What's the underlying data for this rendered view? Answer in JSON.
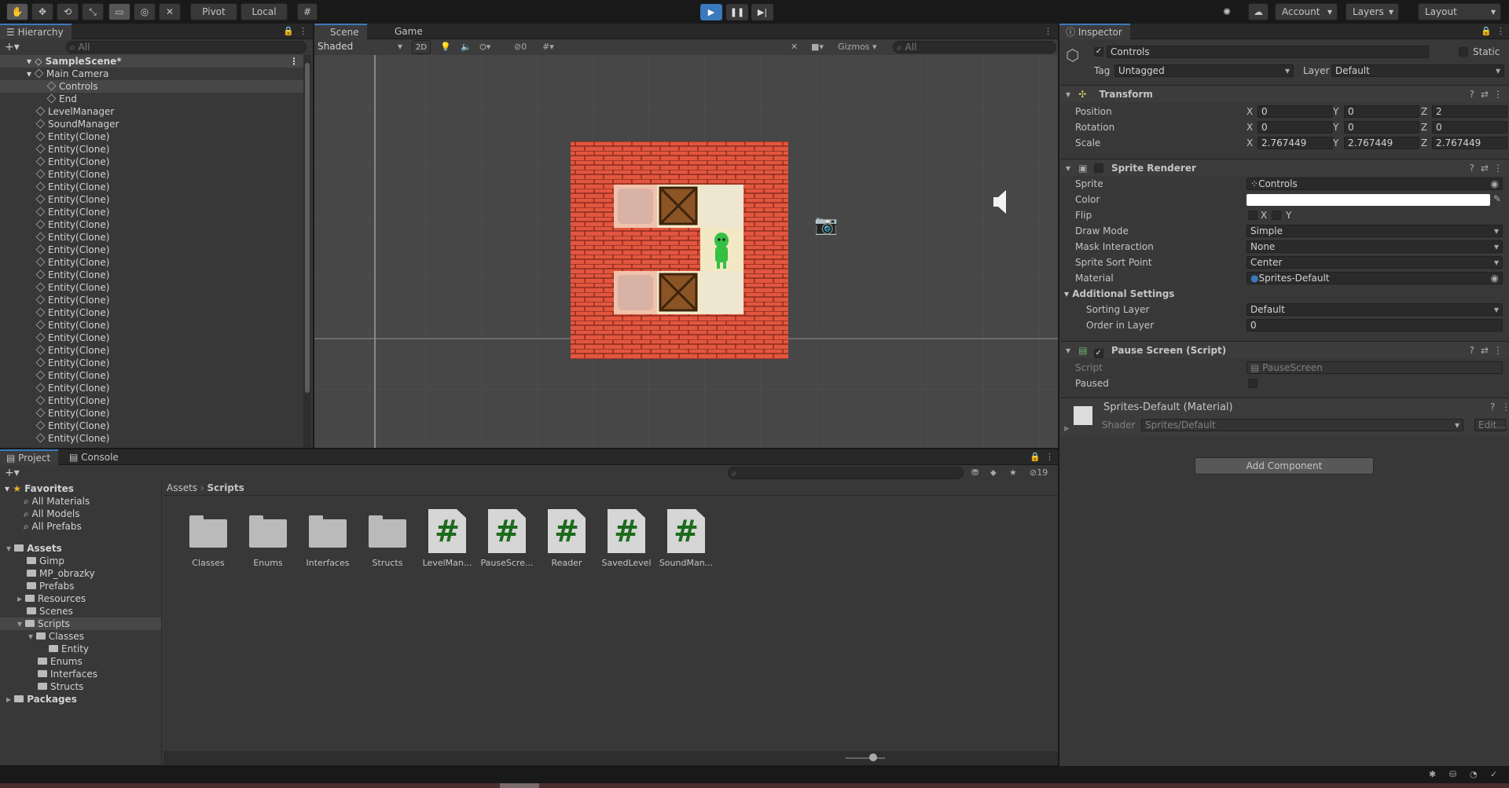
{
  "toolbar": {
    "tools": [
      "hand-tool-icon",
      "move-tool-icon",
      "rotate-tool-icon",
      "scale-tool-icon",
      "rect-tool-icon",
      "transform-tool-icon",
      "custom-tool-icon"
    ],
    "pivot_label": "Pivot",
    "local_label": "Local",
    "account_label": "Account",
    "layers_label": "Layers",
    "layout_label": "Layout"
  },
  "hierarchy": {
    "tab_label": "Hierarchy",
    "search_placeholder": "All",
    "scene_name": "SampleScene*",
    "items": [
      {
        "label": "Main Camera",
        "indent": 1,
        "expanded": true
      },
      {
        "label": "Controls",
        "indent": 2,
        "selected": true
      },
      {
        "label": "End",
        "indent": 2
      },
      {
        "label": "LevelManager",
        "indent": 1
      },
      {
        "label": "SoundManager",
        "indent": 1
      },
      {
        "label": "Entity(Clone)",
        "indent": 1
      },
      {
        "label": "Entity(Clone)",
        "indent": 1
      },
      {
        "label": "Entity(Clone)",
        "indent": 1
      },
      {
        "label": "Entity(Clone)",
        "indent": 1
      },
      {
        "label": "Entity(Clone)",
        "indent": 1
      },
      {
        "label": "Entity(Clone)",
        "indent": 1
      },
      {
        "label": "Entity(Clone)",
        "indent": 1
      },
      {
        "label": "Entity(Clone)",
        "indent": 1
      },
      {
        "label": "Entity(Clone)",
        "indent": 1
      },
      {
        "label": "Entity(Clone)",
        "indent": 1
      },
      {
        "label": "Entity(Clone)",
        "indent": 1
      },
      {
        "label": "Entity(Clone)",
        "indent": 1
      },
      {
        "label": "Entity(Clone)",
        "indent": 1
      },
      {
        "label": "Entity(Clone)",
        "indent": 1
      },
      {
        "label": "Entity(Clone)",
        "indent": 1
      },
      {
        "label": "Entity(Clone)",
        "indent": 1
      },
      {
        "label": "Entity(Clone)",
        "indent": 1
      },
      {
        "label": "Entity(Clone)",
        "indent": 1
      },
      {
        "label": "Entity(Clone)",
        "indent": 1
      },
      {
        "label": "Entity(Clone)",
        "indent": 1
      },
      {
        "label": "Entity(Clone)",
        "indent": 1
      },
      {
        "label": "Entity(Clone)",
        "indent": 1
      },
      {
        "label": "Entity(Clone)",
        "indent": 1
      },
      {
        "label": "Entity(Clone)",
        "indent": 1
      },
      {
        "label": "Entity(Clone)",
        "indent": 1
      }
    ]
  },
  "scene": {
    "scene_tab": "Scene",
    "game_tab": "Game",
    "shading_mode": "Shaded",
    "mode_2d": "2D",
    "hidden_count": "0",
    "gizmos_label": "Gizmos",
    "search_placeholder": "All"
  },
  "inspector": {
    "tab_label": "Inspector",
    "object_name": "Controls",
    "static_label": "Static",
    "tag_label": "Tag",
    "tag_value": "Untagged",
    "layer_label": "Layer",
    "layer_value": "Default",
    "transform": {
      "title": "Transform",
      "position_label": "Position",
      "rotation_label": "Rotation",
      "scale_label": "Scale",
      "axis_x": "X",
      "axis_y": "Y",
      "axis_z": "Z",
      "position": [
        "0",
        "0",
        "2"
      ],
      "rotation": [
        "0",
        "0",
        "0"
      ],
      "scale": [
        "2.767449",
        "2.767449",
        "2.767449"
      ]
    },
    "sprite_renderer": {
      "title": "Sprite Renderer",
      "sprite_label": "Sprite",
      "sprite_value": "Controls",
      "color_label": "Color",
      "color_value": "#ffffff",
      "flip_label": "Flip",
      "flip_x": "X",
      "flip_y": "Y",
      "draw_mode_label": "Draw Mode",
      "draw_mode_value": "Simple",
      "mask_label": "Mask Interaction",
      "mask_value": "None",
      "sort_point_label": "Sprite Sort Point",
      "sort_point_value": "Center",
      "material_label": "Material",
      "material_value": "Sprites-Default",
      "additional_label": "Additional Settings",
      "sorting_layer_label": "Sorting Layer",
      "sorting_layer_value": "Default",
      "order_label": "Order in Layer",
      "order_value": "0"
    },
    "pause_screen": {
      "title": "Pause Screen (Script)",
      "script_label": "Script",
      "script_value": "PauseScreen",
      "paused_label": "Paused"
    },
    "material": {
      "title": "Sprites-Default (Material)",
      "shader_label": "Shader",
      "shader_value": "Sprites/Default",
      "edit_label": "Edit..."
    },
    "add_component_label": "Add Component"
  },
  "project": {
    "project_tab": "Project",
    "console_tab": "Console",
    "hidden_count": "19",
    "breadcrumb_root": "Assets",
    "breadcrumb_current": "Scripts",
    "favorites_label": "Favorites",
    "favorites": [
      "All Materials",
      "All Models",
      "All Prefabs"
    ],
    "tree": [
      {
        "label": "Assets",
        "indent": 0,
        "bold": true
      },
      {
        "label": "Gimp",
        "indent": 1
      },
      {
        "label": "MP_obrazky",
        "indent": 1
      },
      {
        "label": "Prefabs",
        "indent": 1
      },
      {
        "label": "Resources",
        "indent": 1
      },
      {
        "label": "Scenes",
        "indent": 1
      },
      {
        "label": "Scripts",
        "indent": 1,
        "selected": true
      },
      {
        "label": "Classes",
        "indent": 2
      },
      {
        "label": "Entity",
        "indent": 3
      },
      {
        "label": "Enums",
        "indent": 2
      },
      {
        "label": "Interfaces",
        "indent": 2
      },
      {
        "label": "Structs",
        "indent": 2
      },
      {
        "label": "Packages",
        "indent": 0,
        "bold": true
      }
    ],
    "assets": [
      {
        "label": "Classes",
        "kind": "folder"
      },
      {
        "label": "Enums",
        "kind": "folder"
      },
      {
        "label": "Interfaces",
        "kind": "folder"
      },
      {
        "label": "Structs",
        "kind": "folder"
      },
      {
        "label": "LevelMan...",
        "kind": "script"
      },
      {
        "label": "PauseScre...",
        "kind": "script"
      },
      {
        "label": "Reader",
        "kind": "script"
      },
      {
        "label": "SavedLevel",
        "kind": "script"
      },
      {
        "label": "SoundMan...",
        "kind": "script"
      }
    ]
  },
  "colors": {
    "accent": "#3a79bb",
    "brick": "#e2563f",
    "floor": "#f3e8c4",
    "player": "#34c043"
  }
}
